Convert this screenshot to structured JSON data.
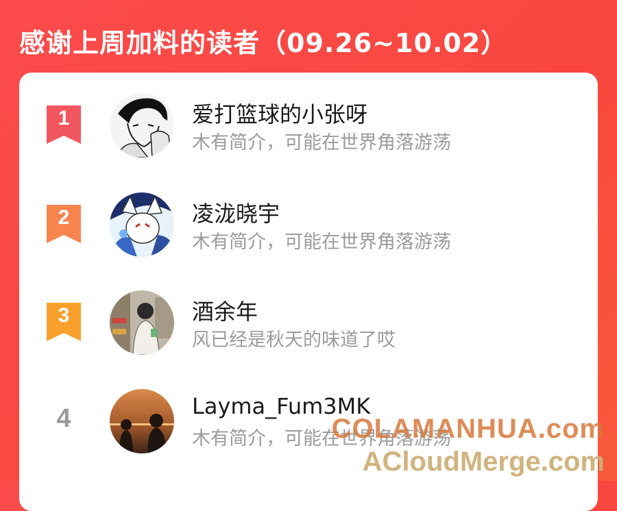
{
  "header": {
    "title": "感谢上周加料的读者（09.26~10.02）"
  },
  "colors": {
    "rank1": "#f2575f",
    "rank2": "#f8854e",
    "rank3": "#f9a12c",
    "background": "#fa4a44"
  },
  "readers": [
    {
      "rank": "1",
      "name": "爱打篮球的小张呀",
      "bio": "木有简介，可能在世界角落游荡"
    },
    {
      "rank": "2",
      "name": "凌泷晓宇",
      "bio": "木有简介，可能在世界角落游荡"
    },
    {
      "rank": "3",
      "name": "酒余年",
      "bio": "风已经是秋天的味道了哎"
    },
    {
      "rank": "4",
      "name": "Layma_Fum3MK",
      "bio": "木有简介，可能在世界角落游荡"
    }
  ],
  "watermark": {
    "line1": "COLAMANHUA.com",
    "line2": "ACloudMerge.com"
  }
}
